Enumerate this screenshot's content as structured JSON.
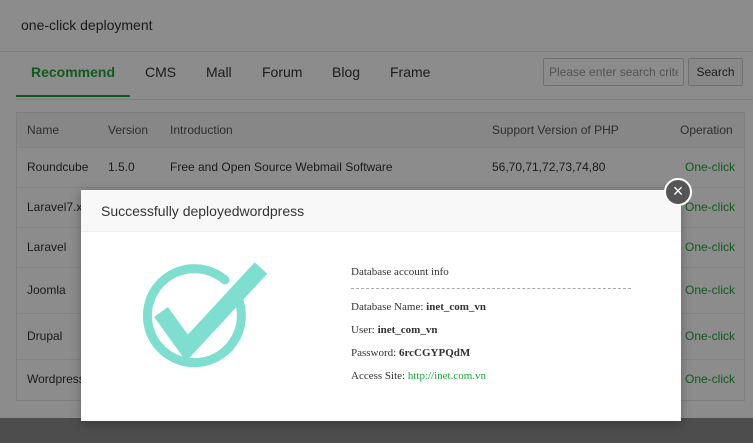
{
  "panel": {
    "title": "one-click deployment",
    "tabs": [
      {
        "label": "Recommend",
        "active": true
      },
      {
        "label": "CMS",
        "active": false
      },
      {
        "label": "Mall",
        "active": false
      },
      {
        "label": "Forum",
        "active": false
      },
      {
        "label": "Blog",
        "active": false
      },
      {
        "label": "Frame",
        "active": false
      }
    ],
    "search": {
      "placeholder": "Please enter search criteria",
      "button_label": "Search"
    },
    "table": {
      "columns": [
        "Name",
        "Version",
        "Introduction",
        "Support Version of PHP",
        "Operation"
      ],
      "rows": [
        {
          "name": "Roundcube",
          "version": "1.5.0",
          "intro": "Free and Open Source Webmail Software",
          "php": "56,70,71,72,73,74,80",
          "op": "One-click"
        },
        {
          "name": "Laravel7.x",
          "version": "",
          "intro": "",
          "php": "",
          "op": "One-click"
        },
        {
          "name": "Laravel",
          "version": "",
          "intro": "",
          "php": "",
          "op": "One-click"
        },
        {
          "name": "Joomla",
          "version": "",
          "intro": "",
          "php": "",
          "op": "One-click"
        },
        {
          "name": "Drupal",
          "version": "",
          "intro": "",
          "php": "",
          "op": "One-click"
        },
        {
          "name": "Wordpress",
          "version": "",
          "intro": "",
          "php": "",
          "op": "One-click"
        }
      ]
    }
  },
  "dialog": {
    "title": "Successfully deployedwordpress",
    "close_icon": "close-icon",
    "check_icon": "check-circle-icon",
    "accent_color": "#7edfd1",
    "info_title": "Database account info",
    "fields": [
      {
        "label": "Database Name: ",
        "value": "inet_com_vn"
      },
      {
        "label": "User: ",
        "value": "inet_com_vn"
      },
      {
        "label": "Password: ",
        "value": "6rcCGYPQdM"
      }
    ],
    "access_label": "Access Site: ",
    "access_url": "http://inet.com.vn"
  },
  "colors": {
    "brand_green": "#20a53a"
  }
}
